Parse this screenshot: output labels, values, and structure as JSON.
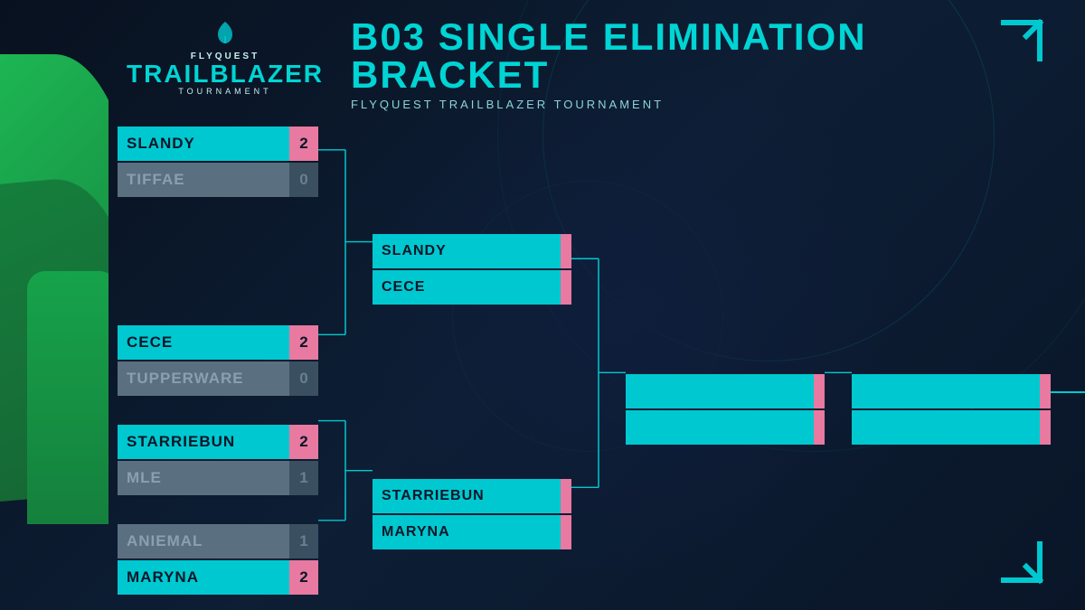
{
  "title": "B03 SINGLE ELIMINATION BRACKET",
  "subtitle": "FLYQUEST TRAILBLAZER TOURNAMENT",
  "logo": {
    "flyquest": "FLYQUEST",
    "trailblazer": "TRAILBLAZER",
    "tournament": "TOURNAMENT"
  },
  "round1": {
    "match1": {
      "player1": {
        "name": "SLANDY",
        "score": "2",
        "winner": true
      },
      "player2": {
        "name": "TIFFAE",
        "score": "0",
        "winner": false
      }
    },
    "match2": {
      "player1": {
        "name": "CECE",
        "score": "2",
        "winner": true
      },
      "player2": {
        "name": "TUPPERWARE",
        "score": "0",
        "winner": false
      }
    },
    "match3": {
      "player1": {
        "name": "STARRIEBUN",
        "score": "2",
        "winner": true
      },
      "player2": {
        "name": "MLE",
        "score": "1",
        "winner": false
      }
    },
    "match4": {
      "player1": {
        "name": "ANIEMAL",
        "score": "1",
        "winner": false
      },
      "player2": {
        "name": "MARYNA",
        "score": "2",
        "winner": true
      }
    }
  },
  "round2": {
    "match1": {
      "player1": {
        "name": "SLANDY",
        "winner": true
      },
      "player2": {
        "name": "CECE",
        "winner": false
      }
    },
    "match2": {
      "player1": {
        "name": "STARRIEBUN",
        "winner": true
      },
      "player2": {
        "name": "MARYNA",
        "winner": false
      }
    }
  },
  "round3": {
    "match1": {
      "player1": {
        "name": "",
        "winner": true
      },
      "player2": {
        "name": "",
        "winner": false
      }
    }
  },
  "round4": {
    "match1": {
      "player1": {
        "name": "",
        "winner": true
      },
      "player2": {
        "name": "",
        "winner": false
      }
    }
  },
  "colors": {
    "cyan": "#00c8d0",
    "pink": "#e879a0",
    "dark_bg": "#0a1628",
    "loser_name": "#5a7080",
    "loser_score": "#3a5060"
  }
}
